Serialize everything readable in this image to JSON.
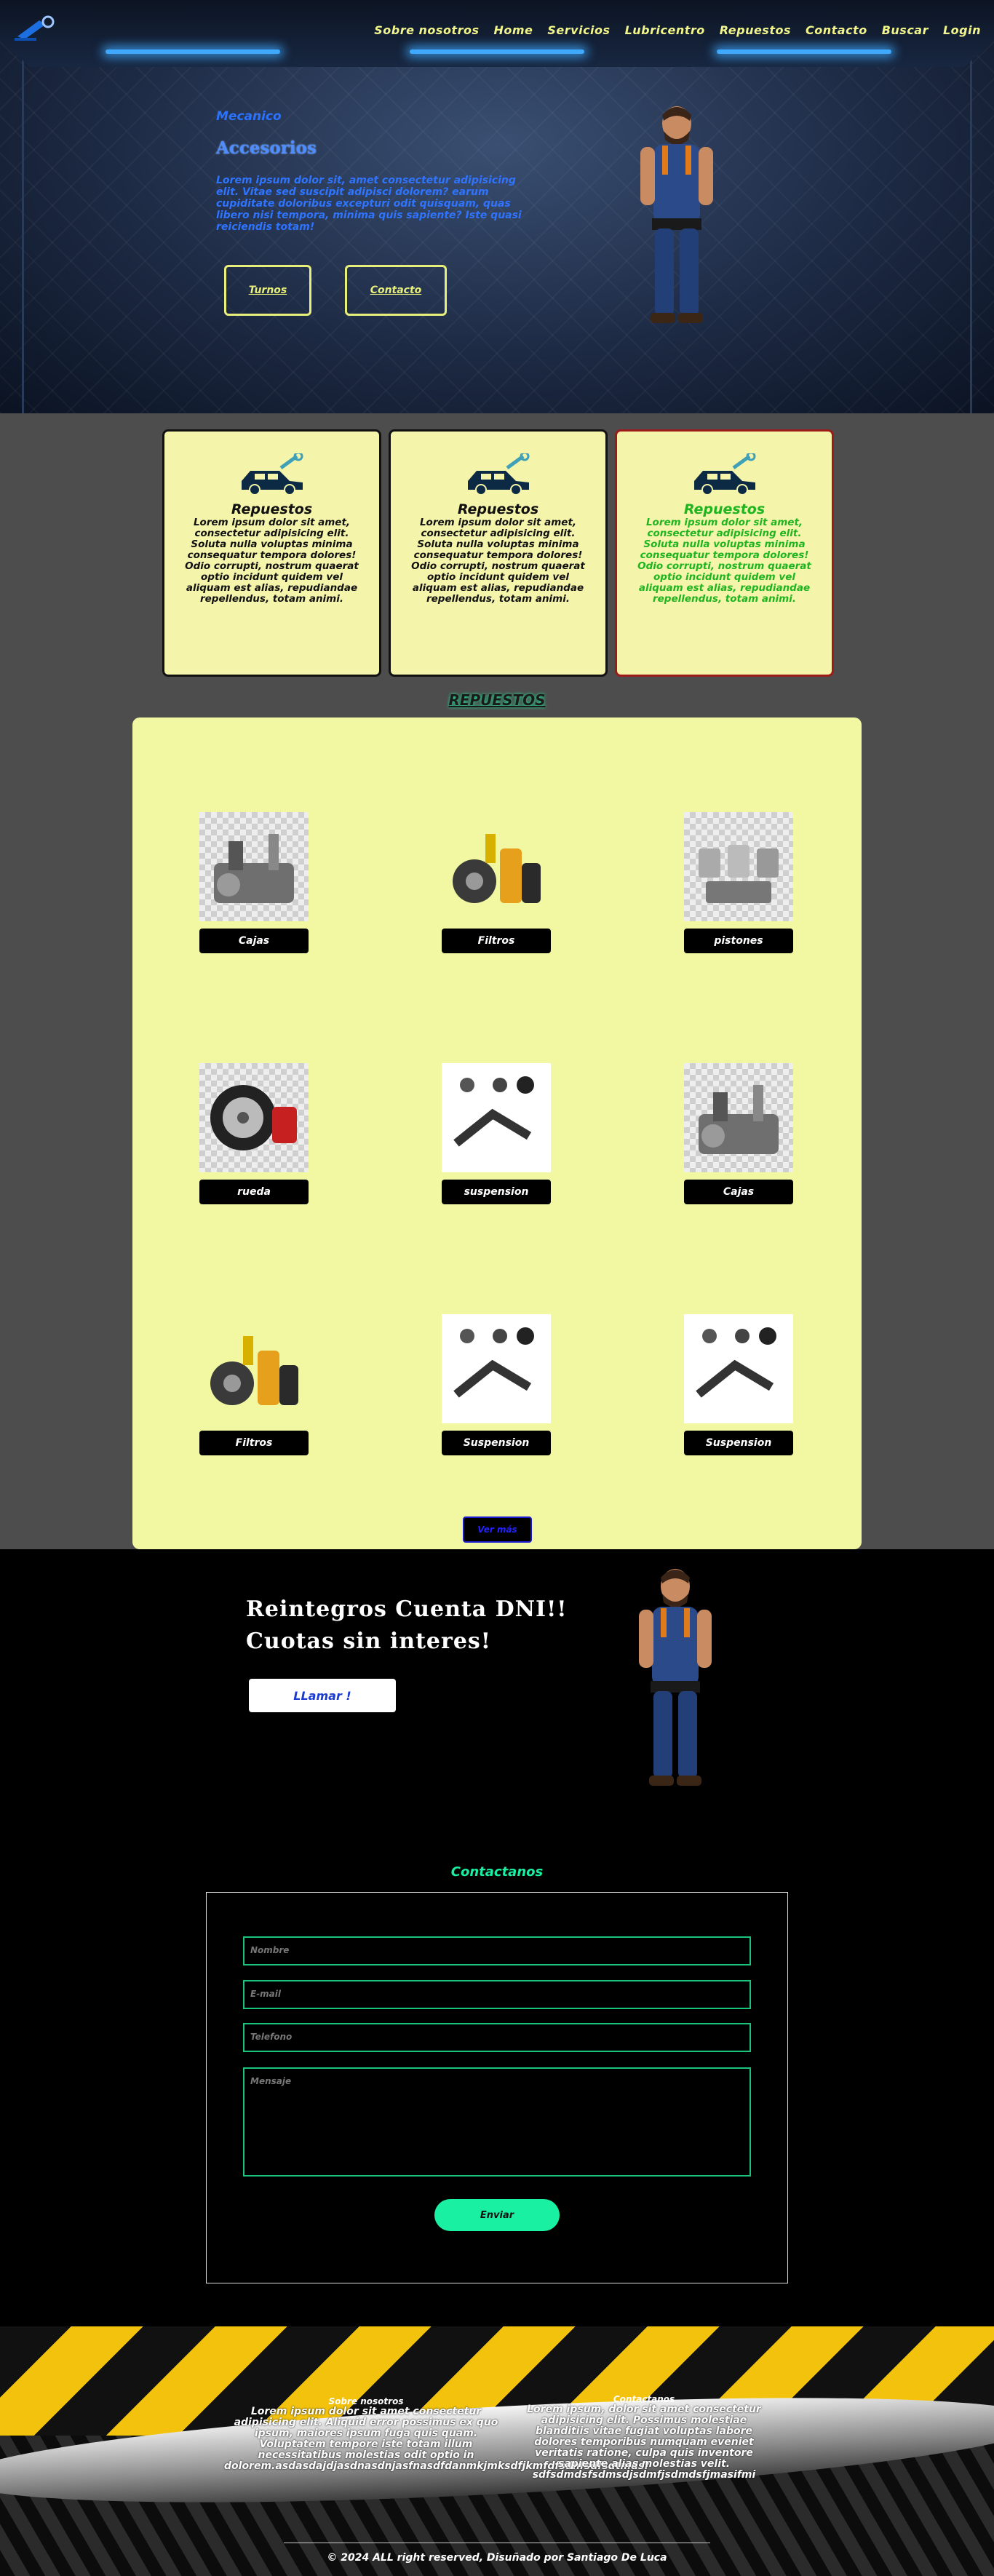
{
  "nav": {
    "items": [
      "Sobre nosotros",
      "Home",
      "Servicios",
      "Lubricentro",
      "Repuestos",
      "Contacto",
      "Buscar",
      "Login"
    ]
  },
  "hero": {
    "kicker": "Mecanico",
    "title": "Accesorios",
    "text": "Lorem ipsum dolor sit, amet consectetur adipisicing elit. Vitae sed suscipit adipisci dolorem? earum cupiditate doloribus excepturi odit quisquam, quas libero nisi tempora, minima quis sapiente? Iste quasi reiciendis totam!",
    "btn_turnos": "Turnos",
    "btn_contacto": "Contacto"
  },
  "cards": [
    {
      "title": "Repuestos",
      "text": "Lorem ipsum dolor sit amet, consectetur adipisicing elit. Soluta nulla voluptas minima consequatur tempora dolores! Odio corrupti, nostrum quaerat optio incidunt quidem vel aliquam est alias, repudiandae repellendus, totam animi."
    },
    {
      "title": "Repuestos",
      "text": "Lorem ipsum dolor sit amet, consectetur adipisicing elit. Soluta nulla voluptas minima consequatur tempora dolores! Odio corrupti, nostrum quaerat optio incidunt quidem vel aliquam est alias, repudiandae repellendus, totam animi."
    },
    {
      "title": "Repuestos",
      "text": "Lorem ipsum dolor sit amet, consectetur adipisicing elit. Soluta nulla voluptas minima consequatur tempora dolores! Odio corrupti, nostrum quaerat optio incidunt quidem vel aliquam est alias, repudiandae repellendus, totam animi."
    }
  ],
  "repuestos": {
    "title": "REPUESTOS",
    "items": [
      "Cajas",
      "Filtros",
      "pistones",
      "rueda",
      "suspension",
      "Cajas",
      "Filtros",
      "Suspension",
      "Suspension"
    ],
    "more_button": "Ver más"
  },
  "promo": {
    "line1": "Reintegros Cuenta DNI!!",
    "line2": "Cuotas sin interes!",
    "call_button": "LLamar !"
  },
  "contact": {
    "title": "Contactanos",
    "name_placeholder": "Nombre",
    "email_placeholder": "E-mail",
    "phone_placeholder": "Telefono",
    "message_placeholder": "Mensaje",
    "send_button": "Enviar"
  },
  "footer": {
    "col1_title": "Sobre nosotros",
    "col1_text": "Lorem ipsum dolor sit amet consectetur adipisicing elit. Aliquid error possimus ex quo ipsum, maiores ipsum fuga quis quam. Voluptatem tempore iste totam illum necessitatibus molestias odit optio in dolorem.asdasdajdjasdnasdnjasfnasdfdanmkjmksdfjkmfdfsdnfsdfsdtmdsf",
    "col2_title": "Contactanos",
    "col2_text": "Lorem ipsum, dolor sit amet consectetur adipisicing elit. Possimus molestiae blanditiis vitae fugiat voluptas labore dolores temporibus numquam eveniet veritatis ratione, culpa quis inventore sapiente alias molestias velit. sdfsdmdsfsdmsdjsdmfjsdmdsfjmasifmi",
    "copyright": "© 2024 ALL right reserved, Disuñado por Santiago De Luca"
  },
  "colors": {
    "accent_yellow": "#f1f58b",
    "hero_blue": "#2f74ff",
    "card_bg": "#f5f4ab",
    "panel_bg": "#f2f8a2",
    "contact_green": "#19f0a1",
    "active_card_text": "#1fb51f"
  }
}
